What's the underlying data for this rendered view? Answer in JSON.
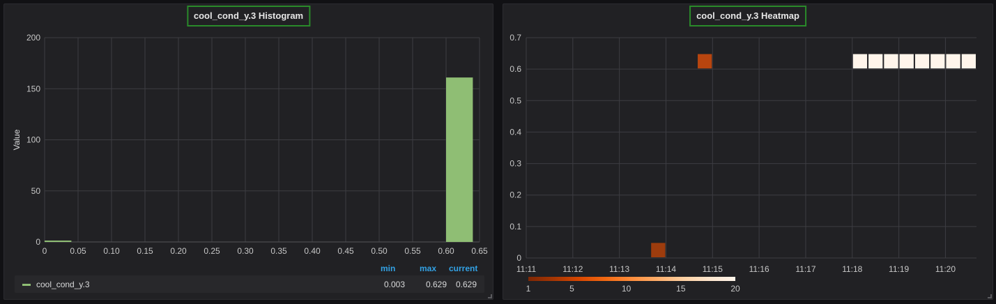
{
  "panels": {
    "left_title": "cool_cond_y.3 Histogram",
    "right_title": "cool_cond_y.3 Heatmap"
  },
  "legend": {
    "headers": {
      "min": "min",
      "max": "max",
      "current": "current"
    },
    "series": {
      "name": "cool_cond_y.3",
      "min": "0.003",
      "max": "0.629",
      "current": "0.629",
      "color": "#8fbe74"
    }
  },
  "chart_data": [
    {
      "type": "bar",
      "title": "cool_cond_y.3 Histogram",
      "ylabel": "Value",
      "xlabel": "",
      "xlim": [
        0,
        0.65
      ],
      "ylim": [
        0,
        200
      ],
      "x_ticks": [
        "0",
        "0.05",
        "0.10",
        "0.15",
        "0.20",
        "0.25",
        "0.30",
        "0.35",
        "0.40",
        "0.45",
        "0.50",
        "0.55",
        "0.60",
        "0.65"
      ],
      "y_ticks": [
        "0",
        "50",
        "100",
        "150",
        "200"
      ],
      "bins": [
        {
          "x0": 0.0,
          "x1": 0.04,
          "value": 1
        },
        {
          "x0": 0.6,
          "x1": 0.64,
          "value": 161
        }
      ],
      "color": "#8fbe74",
      "grid": true
    },
    {
      "type": "heatmap",
      "title": "cool_cond_y.3 Heatmap",
      "ylim": [
        0,
        0.7
      ],
      "y_ticks": [
        "0",
        "0.1",
        "0.2",
        "0.3",
        "0.4",
        "0.5",
        "0.6",
        "0.7"
      ],
      "x_ticks": [
        "11:11",
        "11:12",
        "11:13",
        "11:14",
        "11:15",
        "11:16",
        "11:17",
        "11:18",
        "11:19",
        "11:20"
      ],
      "x_start": "11:11",
      "x_end": "11:20:40",
      "bucket_seconds": 20,
      "y_bucket_size": 0.05,
      "cells": [
        {
          "time": "11:13:40",
          "y": 0.0,
          "count": 2,
          "color": "#9d3c0d"
        },
        {
          "time": "11:14:40",
          "y": 0.6,
          "count": 3,
          "color": "#b8450f"
        },
        {
          "time": "11:18:00",
          "y": 0.6,
          "count": 20,
          "color": "#fff5eb"
        },
        {
          "time": "11:18:20",
          "y": 0.6,
          "count": 20,
          "color": "#fff5eb"
        },
        {
          "time": "11:18:40",
          "y": 0.6,
          "count": 20,
          "color": "#fff5eb"
        },
        {
          "time": "11:19:00",
          "y": 0.6,
          "count": 20,
          "color": "#fff5eb"
        },
        {
          "time": "11:19:20",
          "y": 0.6,
          "count": 20,
          "color": "#fff5eb"
        },
        {
          "time": "11:19:40",
          "y": 0.6,
          "count": 20,
          "color": "#fff5eb"
        },
        {
          "time": "11:20:00",
          "y": 0.6,
          "count": 20,
          "color": "#fff5eb"
        },
        {
          "time": "11:20:20",
          "y": 0.6,
          "count": 20,
          "color": "#fff5eb"
        }
      ],
      "color_scale": {
        "min": 1,
        "max": 20,
        "ticks": [
          "1",
          "5",
          "10",
          "15",
          "20"
        ],
        "colors": [
          "#7f2704",
          "#a63603",
          "#d94801",
          "#f16913",
          "#fd8d3c",
          "#fdae6b",
          "#fdd0a2",
          "#fee6ce",
          "#fff5eb"
        ]
      },
      "grid": true
    }
  ]
}
